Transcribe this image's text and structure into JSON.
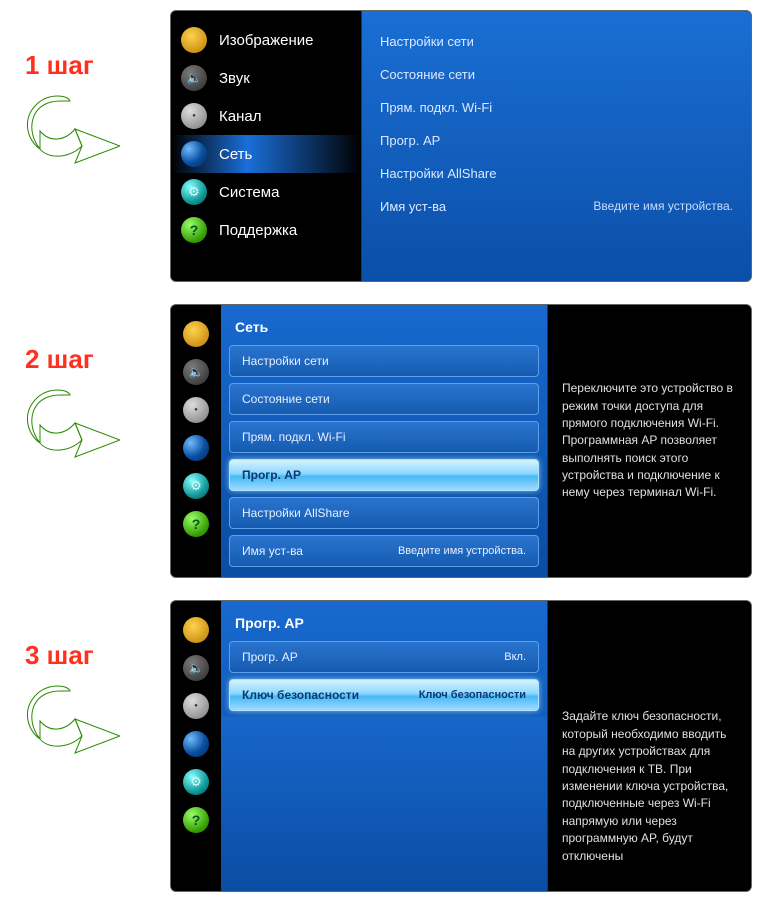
{
  "steps": {
    "s1_label": "1 шаг",
    "s2_label": "2 шаг",
    "s3_label": "3 шаг"
  },
  "sidebar": {
    "image": "Изображение",
    "sound": "Звук",
    "channel": "Канал",
    "network": "Сеть",
    "system": "Система",
    "support": "Поддержка"
  },
  "step1_submenu": {
    "net_settings": "Настройки сети",
    "net_status": "Состояние сети",
    "wifi_direct": "Прям. подкл. Wi-Fi",
    "soft_ap": "Прогр. AP",
    "allshare": "Настройки AllShare",
    "device_name_label": "Имя уст-ва",
    "device_name_value": "Введите имя устройства."
  },
  "step2_panel": {
    "title": "Сеть",
    "items": {
      "net_settings": "Настройки сети",
      "net_status": "Состояние сети",
      "wifi_direct": "Прям. подкл. Wi-Fi",
      "soft_ap": "Прогр. AP",
      "allshare": "Настройки AllShare",
      "device_name_label": "Имя уст-ва",
      "device_name_value": "Введите имя устройства."
    },
    "help": "Переключите это устройство в режим точки доступа для прямого подключения Wi-Fi. Программная AP позволяет выполнять поиск этого устройства и подключение к нему через терминал Wi-Fi."
  },
  "step3_panel": {
    "title": "Прогр. AP",
    "items": {
      "soft_ap_label": "Прогр. AP",
      "soft_ap_value": "Вкл.",
      "security_key_label": "Ключ безопасности",
      "security_key_value": "Ключ безопасности"
    },
    "help": "Задайте ключ безопасности, который необходимо вводить на других устройствах для подключения к ТВ. При изменении ключа устройства, подключенные через Wi-Fi напрямую или через программную AP, будут отключены"
  }
}
